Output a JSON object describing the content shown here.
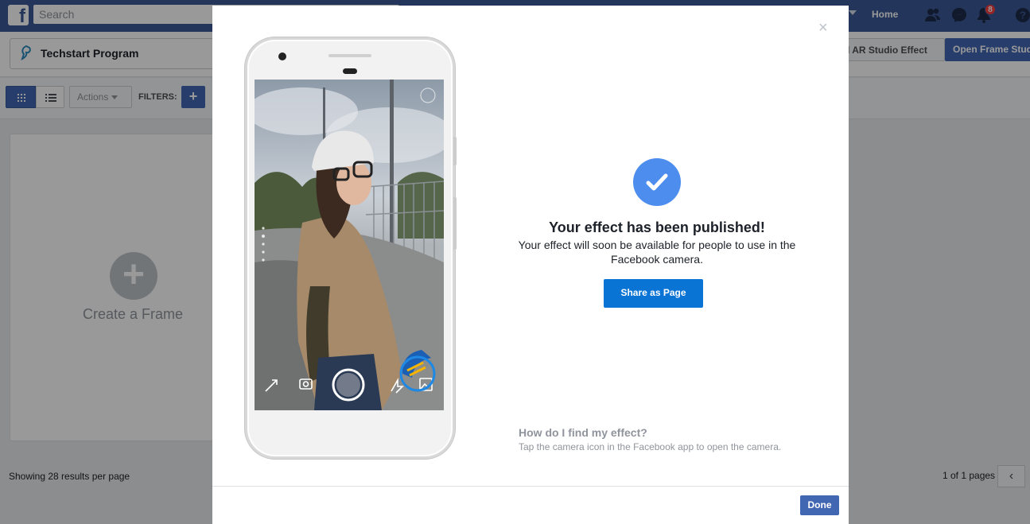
{
  "topbar": {
    "search_placeholder": "Search",
    "home_label": "Home",
    "notification_count": "8",
    "icons": [
      "facebook-logo-icon",
      "friends-icon",
      "messenger-icon",
      "notifications-icon",
      "help-icon"
    ]
  },
  "header": {
    "program_name": "Techstart Program",
    "ar_studio_button": "d AR Studio Effect",
    "frame_studio_button": "Open Frame Studio"
  },
  "toolbar": {
    "actions_label": "Actions",
    "filters_label": "FILTERS:",
    "add_filter_label": "+"
  },
  "grid": {
    "create_plus": "+",
    "create_label": "Create a Frame"
  },
  "footer": {
    "showing": "Showing 28 results per page",
    "pages": "1 of 1 pages",
    "prev": "‹"
  },
  "modal": {
    "close": "×",
    "title": "Your effect has been published!",
    "description": "Your effect will soon be available for people to use in the Facebook camera.",
    "share_button": "Share as Page",
    "how_title": "How do I find my effect?",
    "how_description": "Tap the camera icon in the Facebook app to open the camera.",
    "done_button": "Done"
  },
  "colors": {
    "facebook_blue": "#3b5998",
    "button_blue": "#4267b2",
    "share_blue": "#0a74d5",
    "check_blue": "#4c8dee"
  }
}
